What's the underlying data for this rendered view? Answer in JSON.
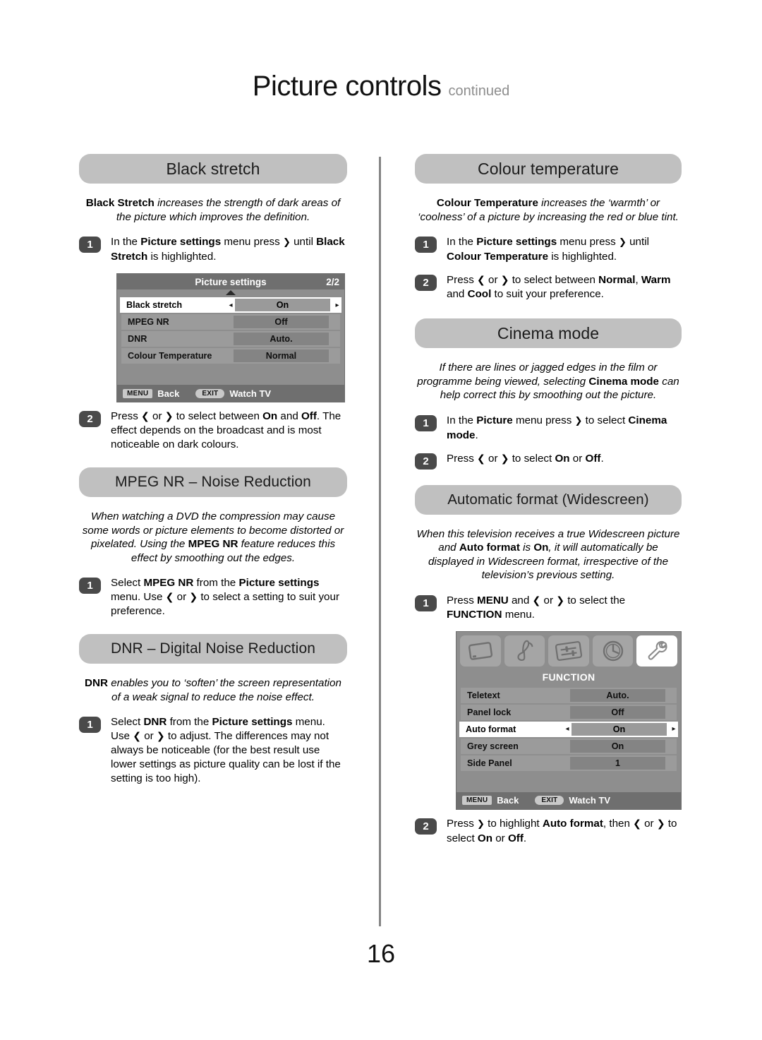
{
  "header": {
    "title": "Picture controls",
    "continued": "continued"
  },
  "page_number": "16",
  "left_column": {
    "sections": [
      {
        "heading": "Black stretch",
        "intro_html": "<b>Black Stretch</b> <i>increases the strength of dark areas of the picture which improves the definition.</i>",
        "steps": [
          {
            "number": "1",
            "html": "In the <b>Picture settings</b> menu press <span class='arrd'>❯</span> until <b>Black Stretch</b> is highlighted."
          }
        ]
      }
    ],
    "picture_settings_menu": {
      "title": "Picture settings",
      "page_indicator": "2/2",
      "rows": [
        {
          "label": "Black stretch",
          "value": "On",
          "selected": true
        },
        {
          "label": "MPEG NR",
          "value": "Off",
          "selected": false
        },
        {
          "label": "DNR",
          "value": "Auto.",
          "selected": false
        },
        {
          "label": "Colour Temperature",
          "value": "Normal",
          "selected": false
        }
      ],
      "footer": {
        "menu_key": "MENU",
        "menu_action": "Back",
        "exit_key": "EXIT",
        "exit_action": "Watch TV"
      }
    },
    "black_stretch_step2": {
      "number": "2",
      "html": "Press <span class='arr'>❮</span> or <span class='arr'>❯</span> to select between <b>On</b> and <b>Off</b>. The effect depends on the broadcast and is most noticeable on dark colours."
    },
    "mpeg_nr": {
      "heading": "MPEG NR – Noise Reduction",
      "intro_html": "<i>When watching a DVD the compression may cause some words or picture elements to become distorted or pixelated. Using the </i><b>MPEG NR</b><i> feature reduces this effect by smoothing out the edges.</i>",
      "steps": [
        {
          "number": "1",
          "html": "Select <b>MPEG NR</b> from the <b>Picture settings</b> menu. Use <span class='arr'>❮</span> or <span class='arr'>❯</span> to select a setting to suit your preference."
        }
      ]
    },
    "dnr": {
      "heading": "DNR – Digital Noise Reduction",
      "intro_html": "<b>DNR</b> <i>enables you to ‘soften’ the screen representation of a weak signal to reduce the noise effect.</i>",
      "steps": [
        {
          "number": "1",
          "html": "Select <b>DNR</b> from the <b>Picture settings</b> menu. Use <span class='arr'>❮</span> or <span class='arr'>❯</span> to adjust. The differences may not always be noticeable (for the best result use lower settings as picture quality can be lost if the setting is too high)."
        }
      ]
    }
  },
  "right_column": {
    "colour_temperature": {
      "heading": "Colour temperature",
      "intro_html": "<b>Colour Temperature</b> <i>increases the ‘warmth’ or ‘coolness’ of a picture by increasing the red or blue tint.</i>",
      "steps": [
        {
          "number": "1",
          "html": "In the <b>Picture settings</b> menu press <span class='arrd'>❯</span> until <b>Colour Temperature</b> is highlighted."
        },
        {
          "number": "2",
          "html": "Press <span class='arr'>❮</span> or <span class='arr'>❯</span> to select between <b>Normal</b>, <b>Warm</b> and <b>Cool</b> to suit your preference."
        }
      ]
    },
    "cinema_mode": {
      "heading": "Cinema mode",
      "intro_html": "<i>If there are lines or jagged edges in the film or programme being viewed, selecting </i><b>Cinema mode</b><i> can help correct this by smoothing out the picture.</i>",
      "steps": [
        {
          "number": "1",
          "html": "In the <b>Picture</b> menu press <span class='arrd'>❯</span> to select <b>Cinema mode</b>."
        },
        {
          "number": "2",
          "html": "Press <span class='arr'>❮</span> or <span class='arr'>❯</span> to select <b>On</b> or <b>Off</b>."
        }
      ]
    },
    "automatic_format": {
      "heading": "Automatic format (Widescreen)",
      "intro_html": "<i>When this television receives a true Widescreen picture and </i><b>Auto format</b><i> is </i><b>On</b><i>, it will automatically be displayed in Widescreen format, irrespective of the television’s previous setting.</i>",
      "step1": {
        "number": "1",
        "html": "Press <b>MENU</b> and <span class='arr'>❮</span> or <span class='arr'>❯</span> to select the <b>FUNCTION</b> menu."
      },
      "step2": {
        "number": "2",
        "html": "Press <span class='arrd'>❯</span> to highlight <b>Auto format</b>, then <span class='arr'>❮</span> or <span class='arr'>❯</span> to select <b>On</b> or <b>Off</b>."
      }
    },
    "function_menu": {
      "title": "FUNCTION",
      "tabs": [
        {
          "icon": "picture-icon",
          "active": false
        },
        {
          "icon": "sound-note-icon",
          "active": false
        },
        {
          "icon": "feature-sliders-icon",
          "active": false
        },
        {
          "icon": "clock-icon",
          "active": false
        },
        {
          "icon": "wrench-icon",
          "active": true
        }
      ],
      "rows": [
        {
          "label": "Teletext",
          "value": "Auto.",
          "selected": false
        },
        {
          "label": "Panel lock",
          "value": "Off",
          "selected": false
        },
        {
          "label": "Auto format",
          "value": "On",
          "selected": true
        },
        {
          "label": "Grey screen",
          "value": "On",
          "selected": false
        },
        {
          "label": "Side Panel",
          "value": "1",
          "selected": false
        }
      ],
      "footer": {
        "menu_key": "MENU",
        "menu_action": "Back",
        "exit_key": "EXIT",
        "exit_action": "Watch TV"
      }
    }
  },
  "colors": {
    "bar_gray": "#c0c0c0",
    "badge_gray": "#4a4a4a",
    "osd_bg": "#8e8e8e",
    "osd_header": "#6f6f6f",
    "divider": "#858585"
  }
}
